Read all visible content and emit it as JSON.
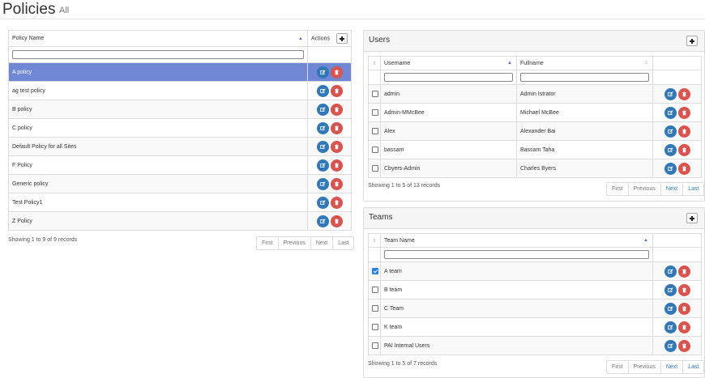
{
  "header": {
    "title": "Policies",
    "subtitle": "All"
  },
  "policies": {
    "col_name": "Policy Name",
    "col_actions": "Actions",
    "filter_value": "",
    "rows": [
      {
        "name": "A policy",
        "selected": true
      },
      {
        "name": "ag test policy"
      },
      {
        "name": "B policy"
      },
      {
        "name": "C policy"
      },
      {
        "name": "Default Policy for all Sites"
      },
      {
        "name": "F Policy"
      },
      {
        "name": "Generic policy"
      },
      {
        "name": "Test Policy1"
      },
      {
        "name": "Z Policy"
      }
    ],
    "info": "Showing 1 to 9 of 9 records",
    "pager": [
      "First",
      "Previous",
      "Next",
      "Last"
    ]
  },
  "users": {
    "title": "Users",
    "col_username": "Username",
    "col_fullname": "Fullname",
    "rows": [
      {
        "username": "admin",
        "fullname": "Admin Istrator",
        "checked": false
      },
      {
        "username": "Admin-MMcBee",
        "fullname": "Michael McBee",
        "checked": false
      },
      {
        "username": "Alex",
        "fullname": "Alexander Bai",
        "checked": false
      },
      {
        "username": "bassam",
        "fullname": "Bassam Taha",
        "checked": false
      },
      {
        "username": "Cbyers-Admin",
        "fullname": "Charles Byers",
        "checked": false
      }
    ],
    "info": "Showing 1 to 5 of 13 records",
    "pager": [
      "First",
      "Previous",
      "Next",
      "Last"
    ]
  },
  "teams": {
    "title": "Teams",
    "col_team": "Team Name",
    "rows": [
      {
        "name": "A team",
        "checked": true
      },
      {
        "name": "B team",
        "checked": false
      },
      {
        "name": "C Team",
        "checked": false
      },
      {
        "name": "K team",
        "checked": false
      },
      {
        "name": "PAI Internal Users",
        "checked": false
      }
    ],
    "info": "Showing 1 to 5 of 7 records",
    "pager": [
      "First",
      "Previous",
      "Next",
      "Last"
    ]
  },
  "colors": {
    "selected_row": "#6f87d5",
    "edit": "#3277b7",
    "delete": "#d9534f",
    "link": "#337ab7"
  },
  "icons": {
    "edit": "edit-icon",
    "delete": "trash-icon",
    "add": "plus-icon",
    "sort": "sort-icon"
  }
}
